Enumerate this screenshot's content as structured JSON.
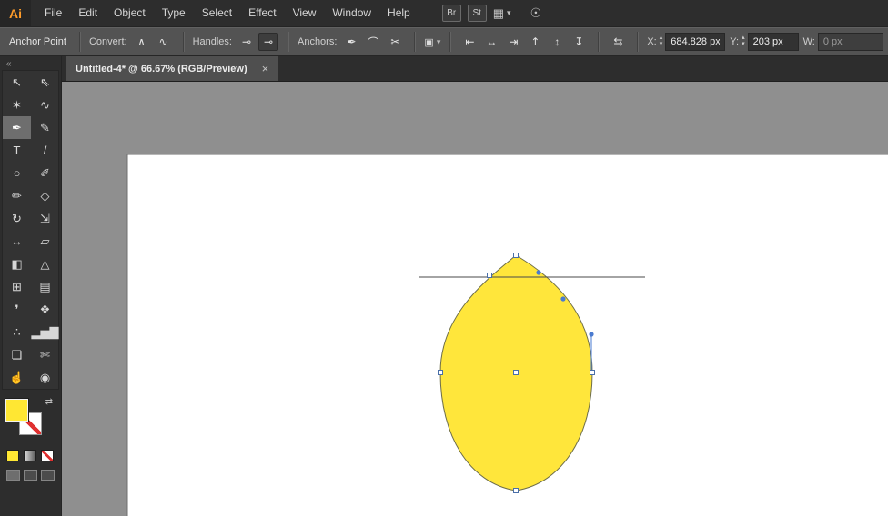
{
  "menubar": {
    "logo": "Ai",
    "items": [
      "File",
      "Edit",
      "Object",
      "Type",
      "Select",
      "Effect",
      "View",
      "Window",
      "Help"
    ],
    "bridge": "Br",
    "stock": "St",
    "workspace_glyph": "▦",
    "chevron_glyph": "▾",
    "sync_glyph": "☉"
  },
  "controlbar": {
    "context_label": "Anchor Point",
    "convert_label": "Convert:",
    "convert_buttons": [
      {
        "name": "convert-to-corner-button",
        "glyph": "∧"
      },
      {
        "name": "convert-to-smooth-button",
        "glyph": "∿"
      }
    ],
    "handles_label": "Handles:",
    "handles_buttons": [
      {
        "name": "show-handles-button",
        "glyph": "⊸"
      },
      {
        "name": "hide-handles-button",
        "glyph": "⊸",
        "pressed": true
      }
    ],
    "anchors_label": "Anchors:",
    "anchors_buttons": [
      {
        "name": "remove-anchors-button",
        "glyph": "✒"
      },
      {
        "name": "connect-anchors-button",
        "glyph": "⌒"
      },
      {
        "name": "cut-path-button",
        "glyph": "✂"
      }
    ],
    "isolate_glyph": "▣",
    "isolate_chevron": "▾",
    "align_buttons": [
      {
        "name": "align-left-button",
        "glyph": "⇤"
      },
      {
        "name": "align-center-button",
        "glyph": "↔"
      },
      {
        "name": "align-right-button",
        "glyph": "⇥"
      },
      {
        "name": "align-top-button",
        "glyph": "↥"
      },
      {
        "name": "align-middle-button",
        "glyph": "↕"
      },
      {
        "name": "align-bottom-button",
        "glyph": "↧"
      }
    ],
    "distribute_glyph": "⇆",
    "stepper_up": "▴",
    "stepper_down": "▾",
    "x_label": "X:",
    "x_value": "684.828 px",
    "y_label": "Y:",
    "y_value": "203 px",
    "w_label": "W:",
    "w_value": "0 px"
  },
  "tab": {
    "title": "Untitled-4* @ 66.67% (RGB/Preview)",
    "close": "×"
  },
  "sidebar": {
    "collapse": "«",
    "swap_glyph": "⇄",
    "tools": [
      {
        "name": "selection",
        "glyph": "↖"
      },
      {
        "name": "direct-selection",
        "glyph": "⇖"
      },
      {
        "name": "magic-wand",
        "glyph": "✶"
      },
      {
        "name": "lasso",
        "glyph": "∿"
      },
      {
        "name": "pen",
        "glyph": "✒",
        "selected": true
      },
      {
        "name": "curvature",
        "glyph": "✎"
      },
      {
        "name": "type",
        "glyph": "T"
      },
      {
        "name": "line-segment",
        "glyph": "/"
      },
      {
        "name": "ellipse",
        "glyph": "○"
      },
      {
        "name": "paintbrush",
        "glyph": "✐"
      },
      {
        "name": "pencil",
        "glyph": "✏"
      },
      {
        "name": "eraser",
        "glyph": "◇"
      },
      {
        "name": "rotate",
        "glyph": "↻"
      },
      {
        "name": "scale",
        "glyph": "⇲"
      },
      {
        "name": "width",
        "glyph": "↔"
      },
      {
        "name": "free-transform",
        "glyph": "▱"
      },
      {
        "name": "shape-builder",
        "glyph": "◧"
      },
      {
        "name": "perspective-grid",
        "glyph": "△"
      },
      {
        "name": "mesh",
        "glyph": "⊞"
      },
      {
        "name": "gradient",
        "glyph": "▤"
      },
      {
        "name": "eyedropper",
        "glyph": "❜"
      },
      {
        "name": "blend",
        "glyph": "❖"
      },
      {
        "name": "symbol-sprayer",
        "glyph": "∴"
      },
      {
        "name": "column-graph",
        "glyph": "▂▅▇"
      },
      {
        "name": "artboard",
        "glyph": "❏"
      },
      {
        "name": "slice",
        "glyph": "✄"
      },
      {
        "name": "hand",
        "glyph": "☝"
      },
      {
        "name": "zoom",
        "glyph": "◉"
      }
    ],
    "swatches": {
      "fill_color": "#FFE733",
      "stroke_style": "none"
    }
  },
  "canvas": {
    "background": "#8f8f8f",
    "artboard_color": "#ffffff",
    "shape_fill": "#FFE63B",
    "shape_stroke": "#6d6d49",
    "selection_color": "#4a7bd0"
  }
}
